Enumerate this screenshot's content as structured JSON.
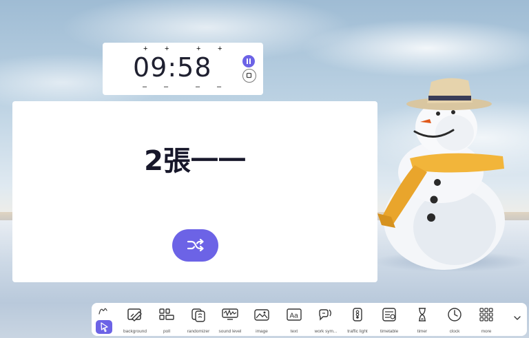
{
  "timer": {
    "time": "09:58",
    "increment_label": "+",
    "decrement_label": "–",
    "pause_icon": "pause-icon",
    "stop_icon": "stop-icon"
  },
  "randomizer": {
    "result": "2張一一",
    "shuffle_icon": "shuffle-icon"
  },
  "toolbar": {
    "items": [
      {
        "label": "background",
        "icon": "background-icon"
      },
      {
        "label": "poll",
        "icon": "poll-icon"
      },
      {
        "label": "randomizer",
        "icon": "randomizer-icon"
      },
      {
        "label": "sound level",
        "icon": "sound-level-icon"
      },
      {
        "label": "image",
        "icon": "image-icon"
      },
      {
        "label": "text",
        "icon": "text-icon"
      },
      {
        "label": "work sym...",
        "icon": "work-symbols-icon"
      },
      {
        "label": "traffic light",
        "icon": "traffic-light-icon"
      },
      {
        "label": "timetable",
        "icon": "timetable-icon"
      },
      {
        "label": "timer",
        "icon": "hourglass-icon"
      },
      {
        "label": "clock",
        "icon": "clock-icon"
      },
      {
        "label": "more",
        "icon": "grid-icon"
      }
    ],
    "expand_icon": "chevron-down-icon",
    "accent_color": "#6c63e6"
  },
  "colors": {
    "accent": "#6c63e6",
    "panel": "#ffffff",
    "text": "#1f2030"
  }
}
